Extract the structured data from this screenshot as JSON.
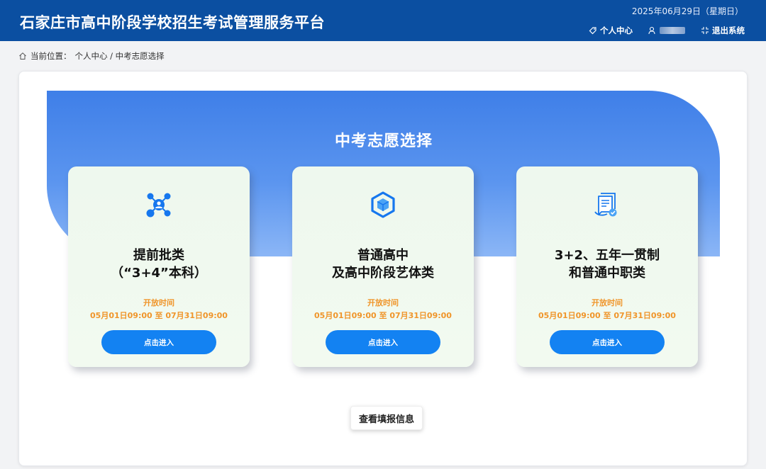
{
  "header": {
    "title": "石家庄市高中阶段学校招生考试管理服务平台",
    "date": "2025年06月29日（星期日）",
    "personal_center": "个人中心",
    "logout": "退出系统"
  },
  "breadcrumb": {
    "label": "当前位置：",
    "path": "个人中心 / 中考志愿选择"
  },
  "page": {
    "title": "中考志愿选择"
  },
  "cards": [
    {
      "icon": "network-user-icon",
      "title_line1": "提前批类",
      "title_line2": "（“3+4”本科）",
      "time_label": "开放时间",
      "time_range": "05月01日09:00 至 07月31日09:00",
      "button": "点击进入"
    },
    {
      "icon": "cube-icon",
      "title_line1": "普通高中",
      "title_line2": "及高中阶段艺体类",
      "time_label": "开放时间",
      "time_range": "05月01日09:00 至 07月31日09:00",
      "button": "点击进入"
    },
    {
      "icon": "document-check-icon",
      "title_line1": "3+2、五年一贯制",
      "title_line2": "和普通中职类",
      "time_label": "开放时间",
      "time_range": "05月01日09:00 至 07月31日09:00",
      "button": "点击进入"
    }
  ],
  "footer": {
    "view_button": "查看填报信息"
  },
  "colors": {
    "header_bg": "#0b4fa1",
    "accent_button": "#1382f2",
    "time_text": "#f0952a",
    "banner": "#4a88ec"
  }
}
